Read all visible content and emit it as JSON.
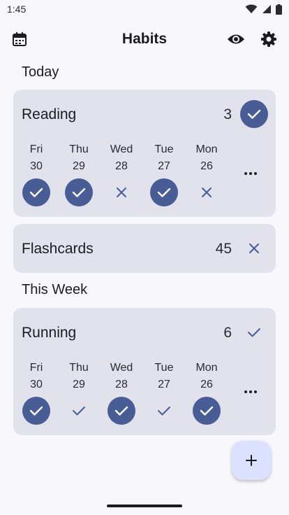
{
  "status_bar": {
    "time": "1:45",
    "icons": [
      "wifi-icon",
      "cellular-icon",
      "battery-icon"
    ]
  },
  "app_bar": {
    "title": "Habits",
    "left_icon": "calendar-icon",
    "right_icons": [
      "eye-icon",
      "gear-icon"
    ]
  },
  "sections": [
    {
      "title": "Today",
      "habits": [
        {
          "name": "Reading",
          "count": "3",
          "today_status": "done",
          "days": [
            {
              "weekday": "Fri",
              "date": "30",
              "status": "done"
            },
            {
              "weekday": "Thu",
              "date": "29",
              "status": "done"
            },
            {
              "weekday": "Wed",
              "date": "28",
              "status": "missed"
            },
            {
              "weekday": "Tue",
              "date": "27",
              "status": "done"
            },
            {
              "weekday": "Mon",
              "date": "26",
              "status": "missed"
            }
          ]
        },
        {
          "name": "Flashcards",
          "count": "45",
          "today_status": "missed"
        }
      ]
    },
    {
      "title": "This Week",
      "habits": [
        {
          "name": "Running",
          "count": "6",
          "today_status": "weekly-done",
          "days": [
            {
              "weekday": "Fri",
              "date": "30",
              "status": "done"
            },
            {
              "weekday": "Thu",
              "date": "29",
              "status": "weekly-done"
            },
            {
              "weekday": "Wed",
              "date": "28",
              "status": "done"
            },
            {
              "weekday": "Tue",
              "date": "27",
              "status": "weekly-done"
            },
            {
              "weekday": "Mon",
              "date": "26",
              "status": "done"
            }
          ]
        }
      ]
    }
  ],
  "more_icon": "more-horizontal-icon",
  "fab_icon": "plus-icon",
  "colors": {
    "accent": "#485d96",
    "card": "#e2e2ec",
    "fab": "#dbe1ff",
    "background": "#f8f7fc"
  }
}
